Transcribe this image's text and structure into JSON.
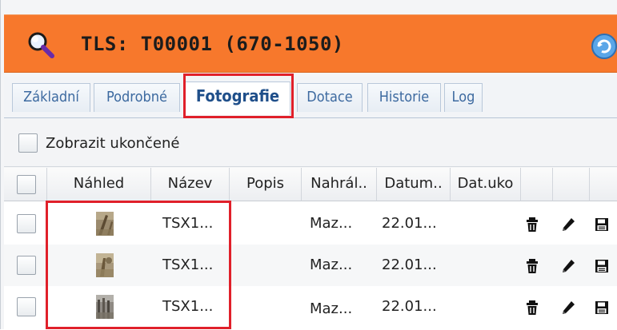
{
  "header": {
    "title": "TLS: T00001 (670-1050)",
    "accent_color": "#f7782c",
    "left_icon": "search-icon",
    "right_icon": "refresh-icon"
  },
  "tabs": [
    {
      "label": "Základní"
    },
    {
      "label": "Podrobné"
    },
    {
      "label": "Fotografie",
      "active": true
    },
    {
      "label": "Dotace"
    },
    {
      "label": "Historie"
    },
    {
      "label": "Log"
    }
  ],
  "toolbar": {
    "show_ended_label": "Zobrazit ukončené"
  },
  "grid": {
    "columns": [
      "Náhled",
      "Název",
      "Popis",
      "Nahrál..",
      "Datum..",
      "Dat.uko"
    ],
    "rows": [
      {
        "name": "TSX1...",
        "description": "",
        "uploaded_by": "Maz...",
        "date": "22.01...",
        "end_date": ""
      },
      {
        "name": "TSX1...",
        "description": "",
        "uploaded_by": "Maz...",
        "date": "22.01...",
        "end_date": ""
      },
      {
        "name": "TSX1...",
        "description": "",
        "uploaded_by": "Maz...",
        "date": "22.01...",
        "end_date": ""
      }
    ],
    "row_actions": [
      "trash-icon",
      "pencil-icon",
      "save-icon"
    ]
  },
  "highlight_color": "#e0202a"
}
